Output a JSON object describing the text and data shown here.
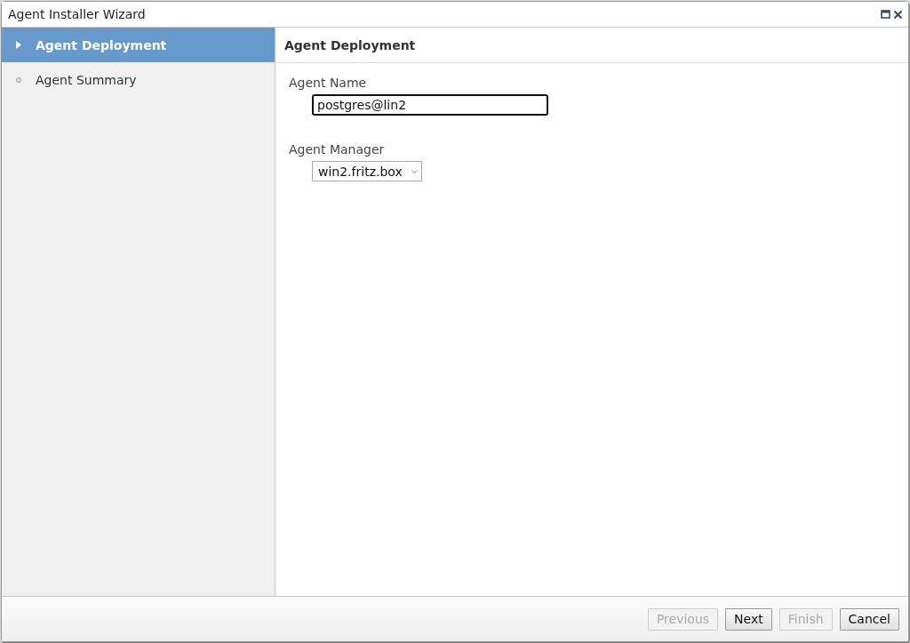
{
  "window": {
    "title": "Agent Installer Wizard"
  },
  "steps": [
    {
      "label": "Agent Deployment",
      "selected": true
    },
    {
      "label": "Agent Summary",
      "selected": false
    }
  ],
  "panel": {
    "title": "Agent Deployment",
    "fields": [
      {
        "kind": "text",
        "label": "Agent Name",
        "value": "postgres@lin2",
        "focused": true
      },
      {
        "kind": "select",
        "label": "Agent Manager",
        "value": "win2.fritz.box"
      }
    ]
  },
  "buttons": [
    {
      "label": "Previous",
      "disabled": true
    },
    {
      "label": "Next",
      "disabled": false
    },
    {
      "label": "Finish",
      "disabled": true
    },
    {
      "label": "Cancel",
      "disabled": false
    }
  ]
}
